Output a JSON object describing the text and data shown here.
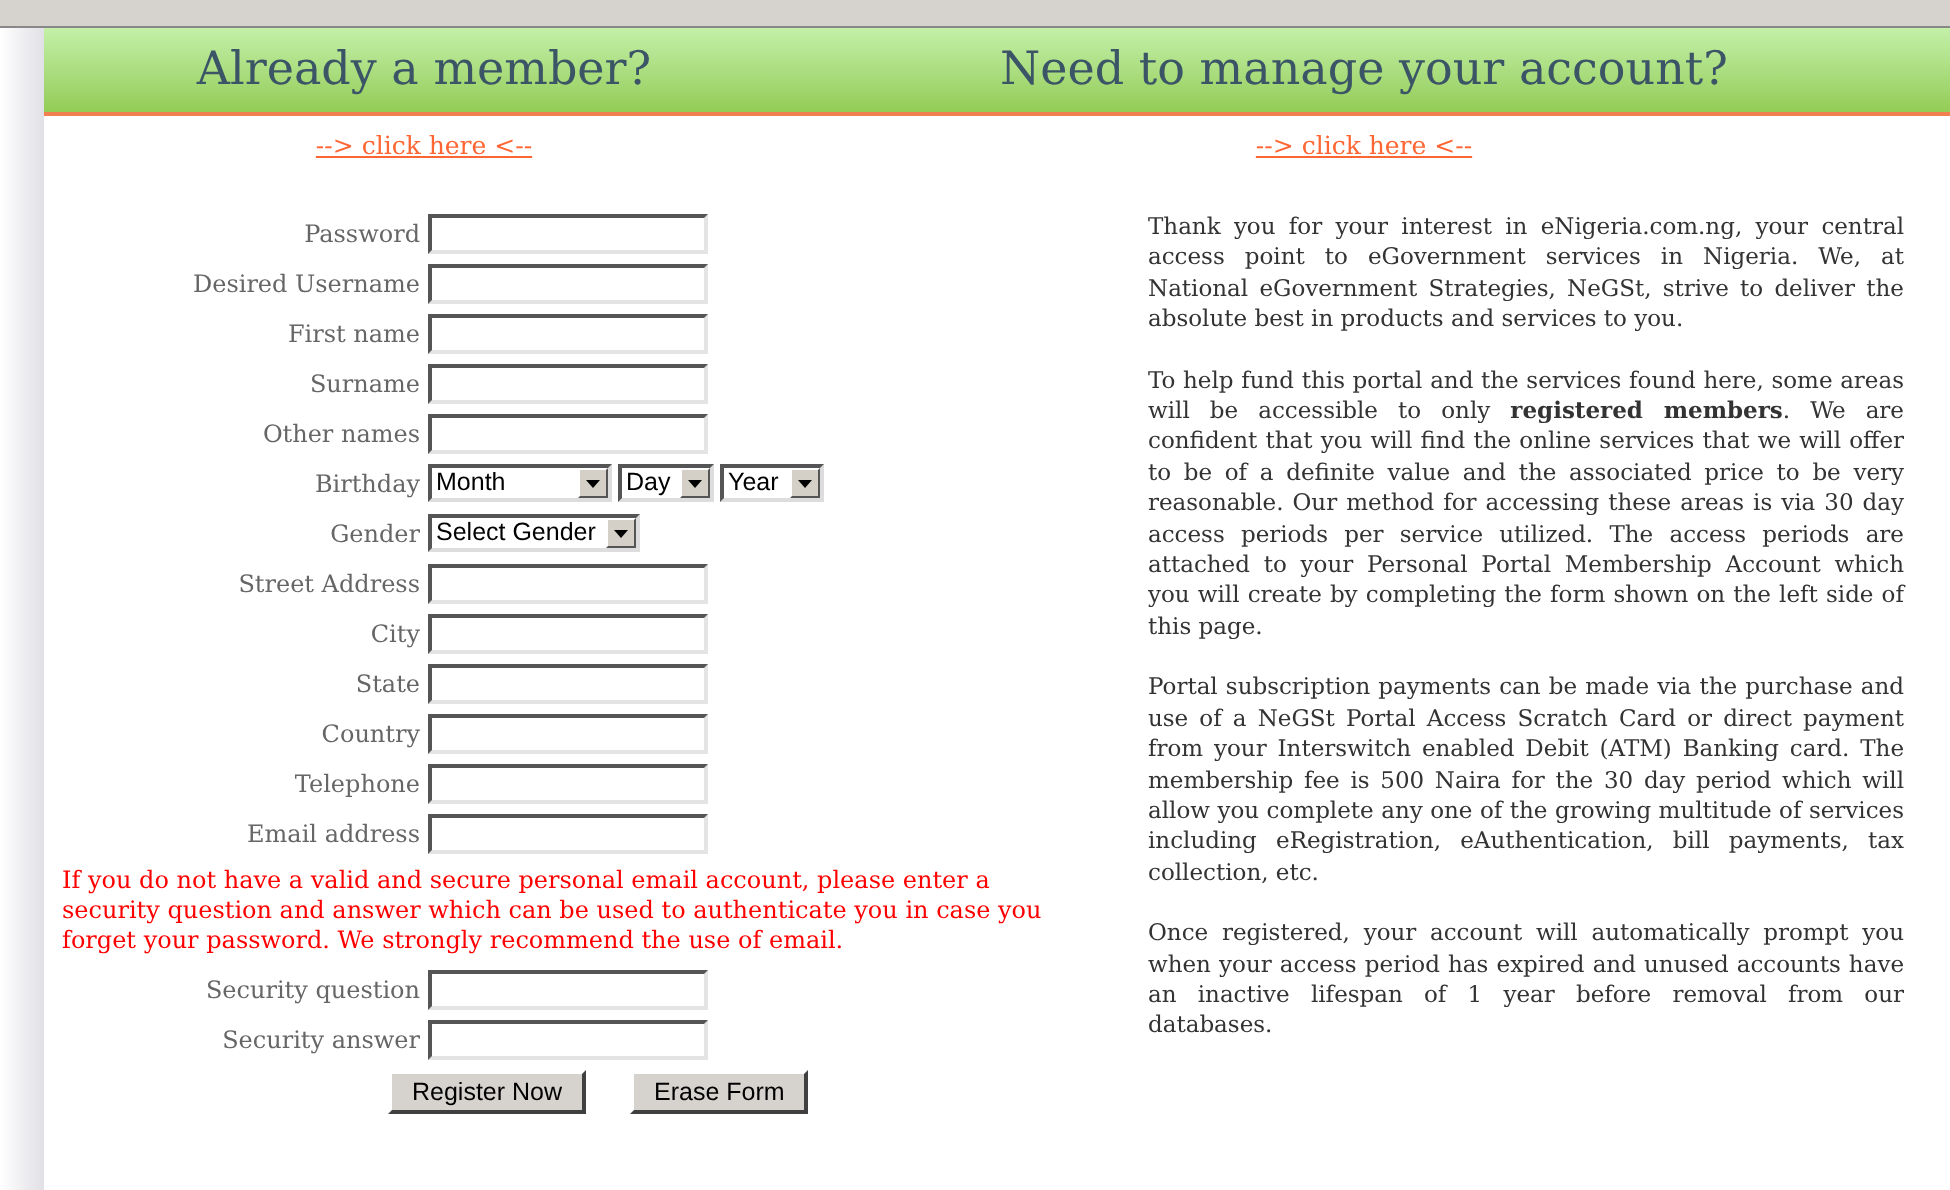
{
  "header": {
    "left_title": "Already a member?",
    "right_title": "Need to manage your account?"
  },
  "links": {
    "left": "--> click here <--",
    "right": "--> click here <--"
  },
  "form": {
    "fields": [
      {
        "kind": "text",
        "label": "Password"
      },
      {
        "kind": "text",
        "label": "Desired Username"
      },
      {
        "kind": "text",
        "label": "First name"
      },
      {
        "kind": "text",
        "label": "Surname"
      },
      {
        "kind": "text",
        "label": "Other names"
      },
      {
        "kind": "selects",
        "label": "Birthday",
        "selects": [
          "Month",
          "Day",
          "Year"
        ]
      },
      {
        "kind": "selects",
        "label": "Gender",
        "selects": [
          "Select Gender"
        ]
      },
      {
        "kind": "text",
        "label": "Street Address"
      },
      {
        "kind": "text",
        "label": "City"
      },
      {
        "kind": "text",
        "label": "State"
      },
      {
        "kind": "text",
        "label": "Country"
      },
      {
        "kind": "text",
        "label": "Telephone"
      },
      {
        "kind": "text",
        "label": "Email address"
      }
    ],
    "note": "If you do not have a valid and secure personal email account, please enter a security question and answer which can be used to authenticate you in case you forget your password. We strongly recommend the use of email.",
    "security_fields": [
      {
        "kind": "text",
        "label": "Security question"
      },
      {
        "kind": "text",
        "label": "Security answer"
      }
    ],
    "buttons": [
      "Register Now",
      "Erase Form"
    ]
  },
  "info": {
    "paragraphs": [
      "Thank you for your interest in eNigeria.com.ng, your central access point to eGovernment services in Nigeria. We, at National eGovernment Strategies, NeGSt, strive to deliver the absolute best in products and services to you.",
      "To help fund this portal and the services found here, some areas will be accessible to only **registered members**. We are confident that you will find the online services that we will offer to be of a definite value and the associated price to be very reasonable. Our method for accessing these areas is via 30 day access periods per service utilized. The access periods are attached to your Personal Portal Membership Account which you will create by completing the form shown on the left side of this page.",
      "Portal subscription payments can be made via the purchase and use of a NeGSt Portal Access Scratch Card or direct payment from your Interswitch enabled Debit (ATM) Banking card. The membership fee is 500 Naira for the 30 day period which will allow you complete any one of the growing multitude of services including eRegistration, eAuthentication, bill payments, tax collection, etc.",
      "Once registered, your account will automatically prompt you when your access period has expired and unused accounts have an inactive lifespan of 1 year before removal from our databases."
    ]
  }
}
